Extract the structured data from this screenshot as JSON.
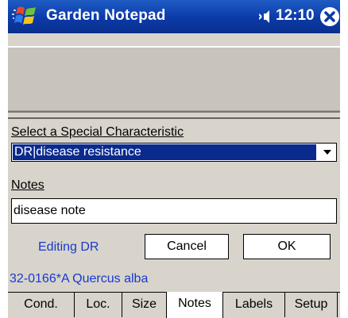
{
  "titlebar": {
    "title": "Garden Notepad",
    "time": "12:10",
    "icons": {
      "start": "windows-flag-icon",
      "volume": "speaker-icon",
      "close": "close-icon"
    }
  },
  "form": {
    "characteristic_label": "Select a Special Characteristic",
    "characteristic_value": "DR|disease resistance",
    "notes_label": "Notes",
    "notes_value": "disease note",
    "status": "Editing DR",
    "cancel_label": "Cancel",
    "ok_label": "OK"
  },
  "record": "32-0166*A Quercus alba",
  "tabs": [
    {
      "label": "Cond."
    },
    {
      "label": "Loc."
    },
    {
      "label": "Size"
    },
    {
      "label": "Notes",
      "active": true
    },
    {
      "label": "Labels"
    },
    {
      "label": "Setup"
    }
  ],
  "colors": {
    "titlebar": "#0b3aa8",
    "selection": "#0a2a8e",
    "link_text": "#1838d0",
    "background": "#d8d4cc"
  }
}
